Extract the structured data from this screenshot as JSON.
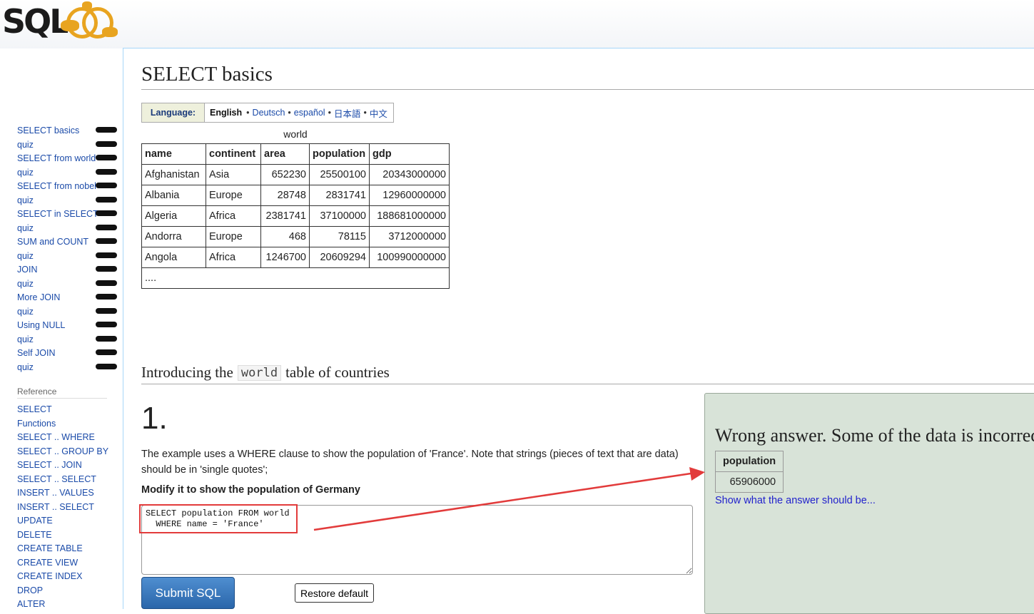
{
  "logo": {
    "text": "SQLZOO"
  },
  "sidebar": {
    "tutorials": [
      {
        "label": "SELECT basics"
      },
      {
        "label": "quiz"
      },
      {
        "label": "SELECT from world"
      },
      {
        "label": "quiz"
      },
      {
        "label": "SELECT from nobel"
      },
      {
        "label": "quiz"
      },
      {
        "label": "SELECT in SELECT"
      },
      {
        "label": "quiz"
      },
      {
        "label": "SUM and COUNT"
      },
      {
        "label": "quiz"
      },
      {
        "label": "JOIN"
      },
      {
        "label": "quiz"
      },
      {
        "label": "More JOIN"
      },
      {
        "label": "quiz"
      },
      {
        "label": "Using NULL"
      },
      {
        "label": "quiz"
      },
      {
        "label": "Self JOIN"
      },
      {
        "label": "quiz"
      }
    ],
    "reference_title": "Reference",
    "reference": [
      "SELECT",
      "Functions",
      "SELECT .. WHERE",
      "SELECT .. GROUP BY",
      "SELECT .. JOIN",
      "SELECT .. SELECT",
      "INSERT .. VALUES",
      "INSERT .. SELECT",
      "UPDATE",
      "DELETE",
      "CREATE TABLE",
      "CREATE VIEW",
      "CREATE INDEX",
      "DROP",
      "ALTER"
    ]
  },
  "page": {
    "title": "SELECT basics",
    "language": {
      "label": "Language:",
      "current": "English",
      "sep": "•",
      "options": [
        "Deutsch",
        "español",
        "日本語",
        "中文"
      ]
    },
    "table": {
      "caption": "world",
      "headers": [
        "name",
        "continent",
        "area",
        "population",
        "gdp"
      ],
      "rows": [
        [
          "Afghanistan",
          "Asia",
          "652230",
          "25500100",
          "20343000000"
        ],
        [
          "Albania",
          "Europe",
          "28748",
          "2831741",
          "12960000000"
        ],
        [
          "Algeria",
          "Africa",
          "2381741",
          "37100000",
          "188681000000"
        ],
        [
          "Andorra",
          "Europe",
          "468",
          "78115",
          "3712000000"
        ],
        [
          "Angola",
          "Africa",
          "1246700",
          "20609294",
          "100990000000"
        ]
      ],
      "ellipsis": "...."
    },
    "section": {
      "pre": "Introducing the",
      "code": "world",
      "post": "table of countries"
    },
    "question": {
      "number": "1.",
      "text": "The example uses a WHERE clause to show the population of 'France'. Note that strings (pieces of text that are data) should be in 'single quotes';",
      "task": "Modify it to show the population of Germany",
      "sql": "SELECT population FROM world\n  WHERE name = 'France'",
      "submit_label": "Submit SQL",
      "restore_label": "Restore default"
    },
    "result": {
      "message": "Wrong answer. Some of the data is incorrect.",
      "header": "population",
      "value": "65906000",
      "link": "Show what the answer should be..."
    }
  },
  "colors": {
    "link": "#1a4aa8",
    "annotation": "#e23b3b",
    "result_bg": "#d8e3d8",
    "submit": "#3a78bd"
  }
}
